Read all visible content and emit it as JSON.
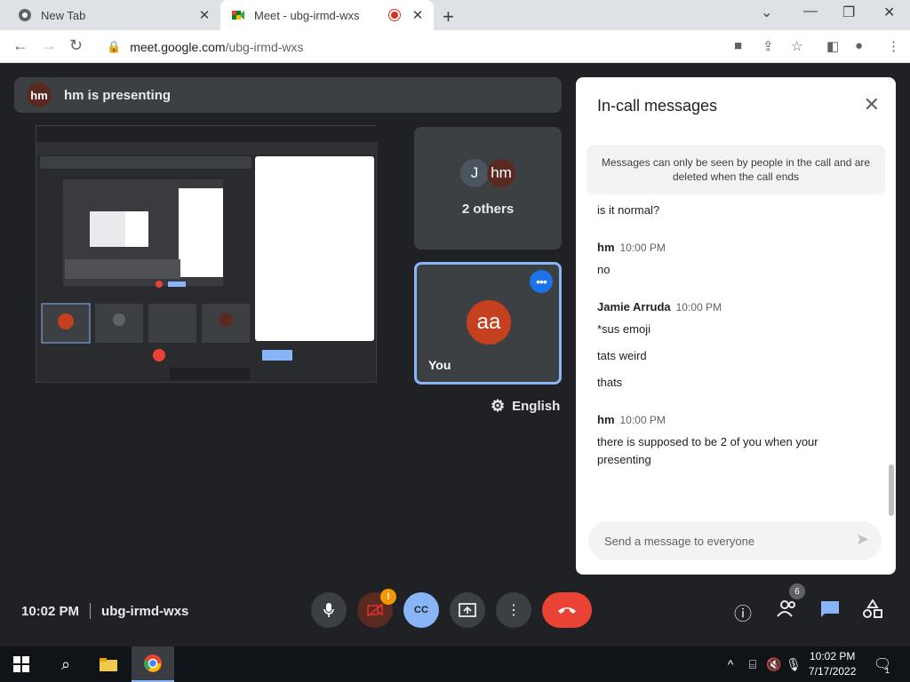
{
  "browser": {
    "tabs": [
      {
        "title": "New Tab",
        "close": "✕"
      },
      {
        "title": "Meet - ubg-irmd-wxs",
        "close": "✕"
      }
    ],
    "new_tab": "+",
    "url_host": "meet.google.com",
    "url_path": "/ubg-irmd-wxs"
  },
  "presentation": {
    "presenter_initials": "hm",
    "banner": "hm is presenting"
  },
  "tiles": {
    "others_initials": [
      "J",
      "hm"
    ],
    "others_label": "2 others",
    "you_initials": "aa",
    "you_label": "You"
  },
  "language": "English",
  "chat": {
    "title": "In-call messages",
    "notice": "Messages can only be seen by people in the call and are deleted when the call ends",
    "messages": [
      {
        "sender": "",
        "time": "",
        "lines": [
          "is it normal?"
        ]
      },
      {
        "sender": "hm",
        "time": "10:00 PM",
        "lines": [
          "no"
        ]
      },
      {
        "sender": "Jamie Arruda",
        "time": "10:00 PM",
        "lines": [
          "*sus emoji",
          "tats weird",
          "thats"
        ]
      },
      {
        "sender": "hm",
        "time": "10:00 PM",
        "lines": [
          "there is supposed to be 2 of you when your presenting"
        ]
      }
    ],
    "placeholder": "Send a message to everyone"
  },
  "meeting": {
    "time": "10:02 PM",
    "code": "ubg-irmd-wxs",
    "people_count": "6",
    "cam_warning": "!"
  },
  "taskbar": {
    "time": "10:02 PM",
    "date": "7/17/2022",
    "notif_count": "1"
  },
  "colors": {
    "accent": "#8ab4f8",
    "end_call": "#ea4335",
    "you_avatar": "#c5401f"
  }
}
